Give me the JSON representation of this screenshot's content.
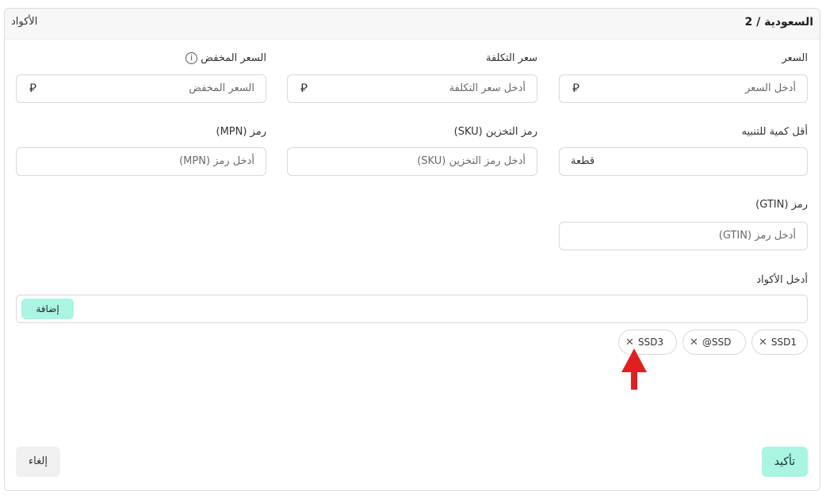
{
  "header": {
    "title": "السعودية / 2",
    "section": "الأكواد"
  },
  "prices": {
    "price": {
      "label": "السعر",
      "placeholder": "أدخل السعر",
      "currency": "⃁"
    },
    "cost": {
      "label": "سعر التكلفة",
      "placeholder": "أدخل سعر التكلفة",
      "currency": "⃁"
    },
    "discount": {
      "label": "السعر المخفض",
      "placeholder": "السعر المخفض",
      "currency": "⃁",
      "info_icon": "i"
    }
  },
  "codes": {
    "min_qty": {
      "label": "أقل كمية للتنبيه",
      "value": "قطعة"
    },
    "sku": {
      "label": "رمز التخزين (SKU)",
      "placeholder": "أدخل رمز التخزين (SKU)"
    },
    "mpn": {
      "label": "رمز (MPN)",
      "placeholder": "أدخل رمز (MPN)"
    },
    "gtin": {
      "label": "رمز (GTIN)",
      "placeholder": "أدخل رمز (GTIN)"
    }
  },
  "keywords": {
    "label": "أدخل الأكواد",
    "add_label": "إضافة",
    "chips": [
      {
        "text": "SSD1"
      },
      {
        "text": "@SSD"
      },
      {
        "text": "SSD3"
      }
    ],
    "remove_glyph": "✕"
  },
  "annotation": {
    "color": "#e02020"
  },
  "footer": {
    "confirm_label": "تأكيد",
    "cancel_label": "إلغاء"
  },
  "colors": {
    "accent": "#a9f5e2",
    "border": "#d9d9d9",
    "header_bg": "#f7f7f7"
  }
}
